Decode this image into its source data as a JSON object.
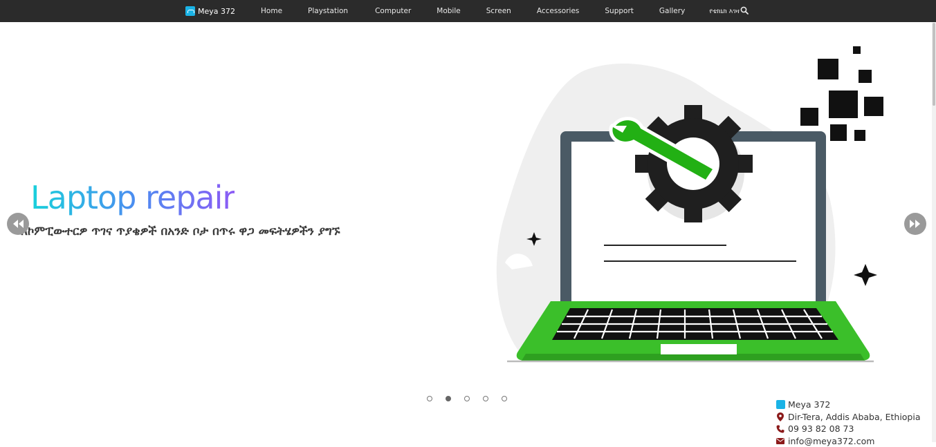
{
  "nav": {
    "brand": "Meya 372",
    "links": [
      "Home",
      "Playstation",
      "Computer",
      "Mobile",
      "Screen",
      "Accessories",
      "Support",
      "Gallery",
      "የቴክኒክ እገዛ"
    ]
  },
  "slide": {
    "title": "Laptop repair",
    "subtitle": "ለኮምፒውተርዎ ጥገና ጥያቄዎች በአንድ ቦታ በጥሩ ዋጋ መፍትሄዎችን ያግኙ"
  },
  "carousel": {
    "slide_count": 5,
    "active_index": 1
  },
  "contact": {
    "name": "Meya 372",
    "address": "Dir-Tera, Addis Ababa, Ethiopia",
    "phone": "09 93 82 08 73",
    "email": "info@meya372.com"
  },
  "colors": {
    "navbar": "#2b2b2b",
    "accent_green": "#3bbf2a",
    "title_gradient": [
      "#19d1db",
      "#4a8ef0",
      "#8c5bf5"
    ],
    "contact_icon": "#8b1a1a"
  },
  "icons": [
    "brand-logo-icon",
    "search-icon",
    "rewind-icon",
    "fast-forward-icon",
    "map-marker-icon",
    "phone-icon",
    "envelope-icon",
    "gear-icon",
    "wrench-icon"
  ]
}
